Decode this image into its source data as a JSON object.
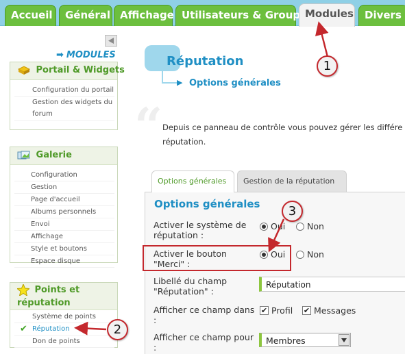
{
  "nav": {
    "tabs": [
      {
        "label": "Accueil"
      },
      {
        "label": "Général"
      },
      {
        "label": "Affichage"
      },
      {
        "label": "Utilisateurs & Groupes"
      },
      {
        "label": "Modules"
      },
      {
        "label": "Divers"
      }
    ],
    "active_tab": "Modules"
  },
  "sidebar": {
    "header_link": "MODULES",
    "sections": [
      {
        "title": "Portail & Widgets",
        "items": [
          "Configuration du portail",
          "Gestion des widgets du forum"
        ]
      },
      {
        "title": "Galerie",
        "items": [
          "Configuration",
          "Gestion",
          "Page d'accueil",
          "Albums personnels",
          "Envoi",
          "Affichage",
          "Style et boutons",
          "Espace disque"
        ]
      },
      {
        "title": "Points et réputation",
        "items": [
          "Système de points",
          "Réputation",
          "Don de points"
        ],
        "active_item": "Réputation"
      }
    ]
  },
  "main": {
    "title": "Réputation",
    "subtitle": "Options générales",
    "intro_line1": "Depuis ce panneau de contrôle vous pouvez gérer les différe",
    "intro_line2": "réputation.",
    "tabs": [
      {
        "label": "Options générales",
        "active": true
      },
      {
        "label": "Gestion de la réputation",
        "active": false
      }
    ],
    "panel_title": "Options générales",
    "fields": {
      "enable_system": {
        "label_l1": "Activer le système de",
        "label_l2": "réputation :",
        "options": [
          "Oui",
          "Non"
        ],
        "selected": "Oui"
      },
      "enable_thanks": {
        "label_l1": "Activer le bouton",
        "label_l2": "\"Merci\" :",
        "options": [
          "Oui",
          "Non"
        ],
        "selected": "Oui"
      },
      "field_label": {
        "label_l1": "Libellé du champ",
        "label_l2": "\"Réputation\" :",
        "value": "Réputation"
      },
      "show_in": {
        "label_l1": "Afficher ce champ dans",
        "label_l2": ":",
        "options": [
          {
            "label": "Profil",
            "checked": true
          },
          {
            "label": "Messages",
            "checked": true
          }
        ]
      },
      "show_for": {
        "label_l1": "Afficher ce champ pour",
        "label_l2": ":",
        "value": "Membres"
      }
    }
  },
  "annotations": {
    "markers": [
      "1",
      "2",
      "3"
    ],
    "color": "#c4282d"
  },
  "colors": {
    "accent_green": "#6cbf3e",
    "accent_blue": "#1f8fc4",
    "topbar": "#8fd0e6"
  }
}
